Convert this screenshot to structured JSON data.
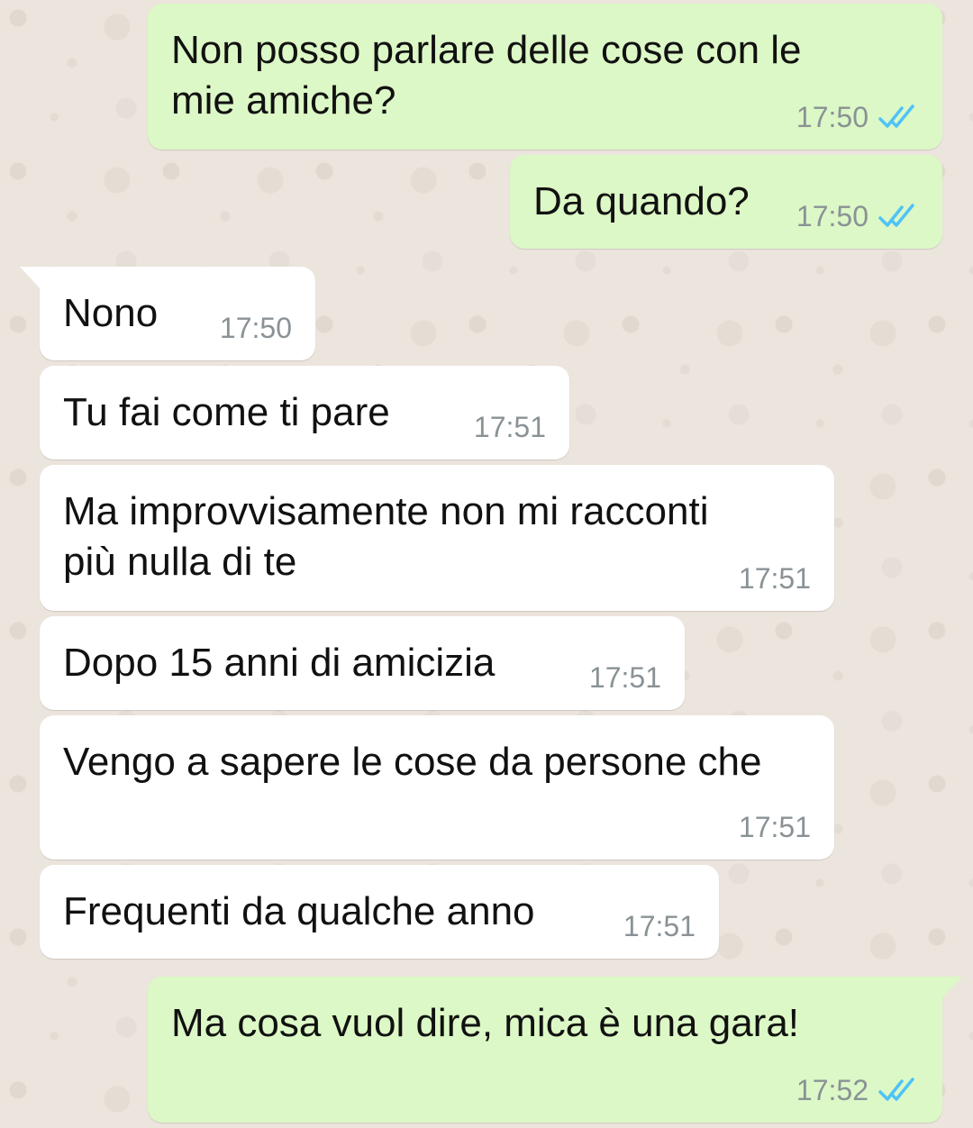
{
  "messages": [
    {
      "text": "Non posso parlare delle cose con le\nmie amiche?",
      "time": "17:50",
      "read": true
    },
    {
      "text": "Da quando?",
      "time": "17:50",
      "read": true
    },
    {
      "text": "Nono",
      "time": "17:50"
    },
    {
      "text": "Tu fai come ti pare",
      "time": "17:51"
    },
    {
      "text": "Ma improvvisamente non mi racconti\npiù nulla di te",
      "time": "17:51"
    },
    {
      "text": "Dopo 15 anni di amicizia",
      "time": "17:51"
    },
    {
      "text": "Vengo a sapere le cose da persone che",
      "time": "17:51"
    },
    {
      "text": "Frequenti da qualche anno",
      "time": "17:51"
    },
    {
      "text": "Ma cosa vuol dire, mica è una gara!",
      "time": "17:52",
      "read": true
    }
  ],
  "colors": {
    "outgoing_bubble": "#DCF8C6",
    "incoming_bubble": "#FFFFFF",
    "read_ticks": "#4FC3F7",
    "timestamp": "#8A9296",
    "wallpaper": "#ECE5DD"
  },
  "icons": {
    "read_receipt": "double-check-icon"
  }
}
